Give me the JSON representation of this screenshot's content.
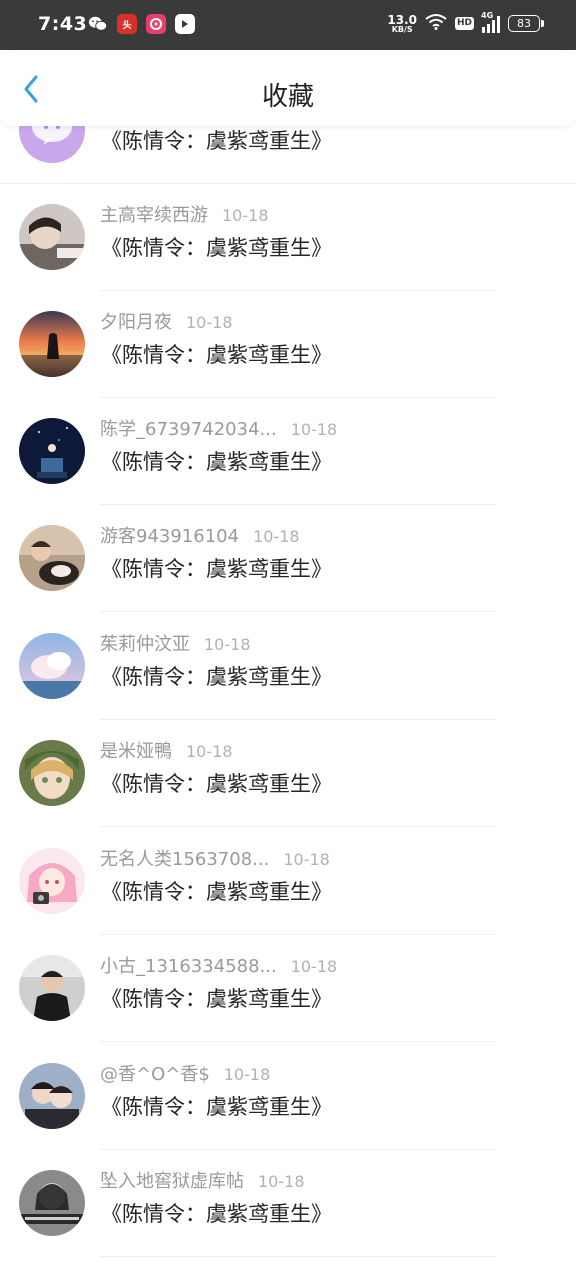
{
  "status_bar": {
    "time": "7:43",
    "net_speed_value": "13.0",
    "net_speed_unit": "KB/S",
    "hd_label": "HD",
    "signal_label": "4G",
    "battery": "83",
    "apps": [
      "toutiao-icon",
      "qq-music-icon",
      "bilibili-icon"
    ]
  },
  "header": {
    "title": "收藏",
    "accent_color": "#3aa0e0"
  },
  "rows": [
    {
      "name": "",
      "date": "",
      "message": "《陈情令：虞紫鸢重生》"
    },
    {
      "name": "主高宰续西游",
      "date": "10-18",
      "message": "《陈情令：虞紫鸢重生》"
    },
    {
      "name": "夕阳月夜",
      "date": "10-18",
      "message": "《陈情令：虞紫鸢重生》"
    },
    {
      "name": "陈学_6739742034...",
      "date": "10-18",
      "message": "《陈情令：虞紫鸢重生》"
    },
    {
      "name": "游客943916104",
      "date": "10-18",
      "message": "《陈情令：虞紫鸢重生》"
    },
    {
      "name": "茱莉仲汶亚",
      "date": "10-18",
      "message": "《陈情令：虞紫鸢重生》"
    },
    {
      "name": "是米娅鴨",
      "date": "10-18",
      "message": "《陈情令：虞紫鸢重生》"
    },
    {
      "name": "无名人类1563708...",
      "date": "10-18",
      "message": "《陈情令：虞紫鸢重生》"
    },
    {
      "name": "小古_1316334588...",
      "date": "10-18",
      "message": "《陈情令：虞紫鸢重生》"
    },
    {
      "name": "@香^O^香$",
      "date": "10-18",
      "message": "《陈情令：虞紫鸢重生》"
    },
    {
      "name": "坠入地窖狱虚库帖",
      "date": "10-18",
      "message": "《陈情令：虞紫鸢重生》"
    }
  ]
}
